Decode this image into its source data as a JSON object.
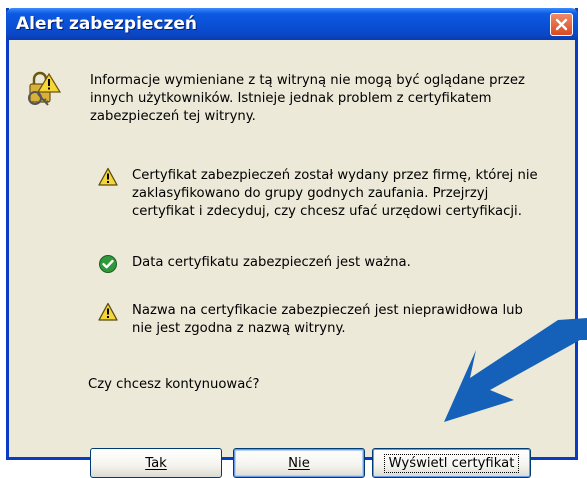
{
  "window": {
    "title": "Alert zabezpieczeń"
  },
  "intro_text_lines": [
    "Informacje wymieniane z tą witryną nie mogą być oglądane przez",
    "innych użytkowników. Istnieje jednak problem z certyfikatem",
    "zabezpieczeń tej witryny."
  ],
  "items": [
    {
      "icon": "warning-icon",
      "lines": [
        "Certyfikat zabezpieczeń został wydany przez firmę, której nie",
        "zaklasyfikowano do grupy godnych zaufania. Przejrzyj",
        "certyfikat i zdecyduj, czy chcesz ufać urzędowi certyfikacji."
      ]
    },
    {
      "icon": "check-icon",
      "lines": [
        "Data certyfikatu zabezpieczeń jest ważna."
      ]
    },
    {
      "icon": "warning-icon",
      "lines": [
        "Nazwa na certyfikacie zabezpieczeń jest nieprawidłowa lub",
        "nie jest zgodna z nazwą witryny."
      ]
    }
  ],
  "question": "Czy chcesz kontynuować?",
  "buttons": {
    "yes_label": "Tak",
    "no_label": "Nie",
    "view_cert_label": "Wyświetl certyfikat"
  },
  "colors": {
    "titlebar": "#0A4FD6",
    "dialog_bg": "#ECE9D8",
    "close_button": "#D84A22",
    "arrow": "#1560B8",
    "warning_fill": "#F5D638",
    "check_fill": "#2E9A3C"
  }
}
